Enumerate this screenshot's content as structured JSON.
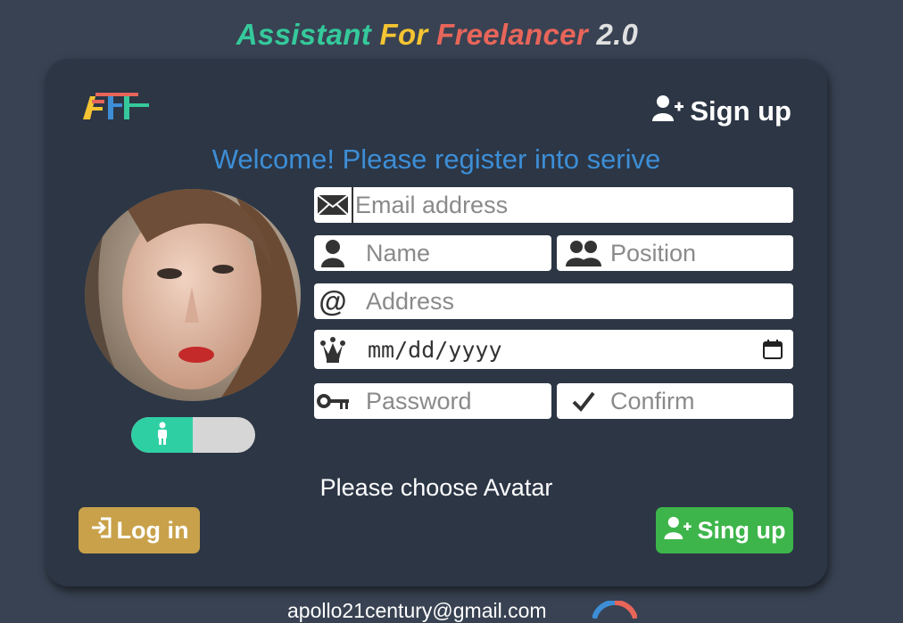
{
  "app_title": {
    "part1": "Assistant",
    "part2": "For",
    "part3": "Freelancer",
    "part4": "2.0",
    "colors": [
      "#35c99b",
      "#f4c432",
      "#e8655a",
      "#e0e0e0"
    ]
  },
  "header": {
    "logo_icon": "aff-logo",
    "signup_label": "Sign up",
    "signup_icon": "user-plus-icon"
  },
  "welcome": "Welcome! Please register into serive",
  "form": {
    "email_placeholder": "Email address",
    "name_placeholder": "Name",
    "position_placeholder": "Position",
    "address_placeholder": "Address",
    "date_placeholder": "mm/dd/yyyy",
    "password_placeholder": "Password",
    "confirm_placeholder": "Confirm"
  },
  "avatar_toggle": {
    "state": "male",
    "icon": "person-icon"
  },
  "choose_avatar": "Please choose Avatar",
  "buttons": {
    "login_label": "Log in",
    "login_icon": "login-icon",
    "signup_label": "Sing up",
    "signup_icon": "user-plus-icon"
  },
  "footer": {
    "email": "apollo21century@gmail.com"
  },
  "colors": {
    "background": "#384252",
    "card": "#2c3645",
    "welcome": "#3d8ed6",
    "login_button": "#c8a14a",
    "signup_button": "#3db54a",
    "toggle_active": "#2fcfa4"
  }
}
